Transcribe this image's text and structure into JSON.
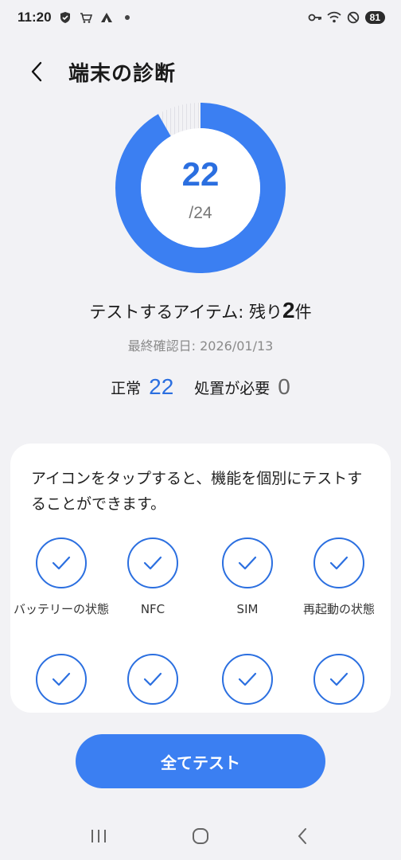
{
  "status_bar": {
    "time": "11:20",
    "battery": "81",
    "icons_left": [
      "shield-icon",
      "cart-icon",
      "camp-icon",
      "dot-icon"
    ],
    "icons_right": [
      "key-icon",
      "wifi-icon",
      "dnd-icon"
    ]
  },
  "header": {
    "title": "端末の診断"
  },
  "progress": {
    "value": "22",
    "total": "/24",
    "fraction": 0.9167,
    "accent": "#3b7ff2"
  },
  "summary": {
    "remaining_prefix": "テストするアイテム: 残り",
    "remaining_count": "2",
    "remaining_suffix": "件",
    "last_checked": "最終確認日: 2026/01/13",
    "normal_label": "正常",
    "normal_count": "22",
    "action_label": "処置が必要",
    "action_count": "0"
  },
  "card": {
    "description": "アイコンをタップすると、機能を個別にテストすることができます。",
    "items": [
      {
        "label": "バッテリーの状態"
      },
      {
        "label": "NFC"
      },
      {
        "label": "SIM"
      },
      {
        "label": "再起動の状態"
      },
      {
        "label": ""
      },
      {
        "label": ""
      },
      {
        "label": ""
      },
      {
        "label": ""
      }
    ]
  },
  "actions": {
    "test_all": "全てテスト"
  }
}
